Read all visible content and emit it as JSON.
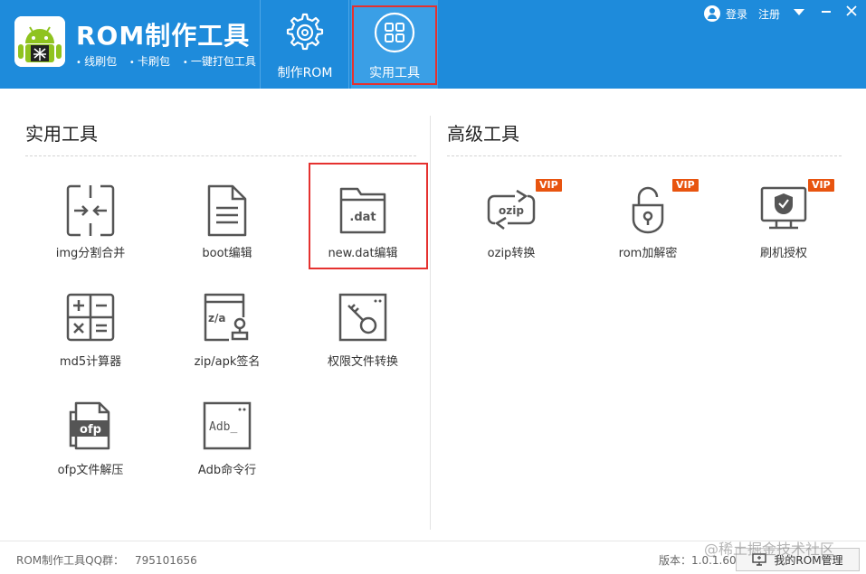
{
  "app": {
    "title": "ROM制作工具",
    "features": [
      "线刷包",
      "卡刷包",
      "一键打包工具"
    ]
  },
  "nav": {
    "tabs": [
      {
        "label": "制作ROM",
        "icon": "gear-disc-icon"
      },
      {
        "label": "实用工具",
        "icon": "grid-icon",
        "active": true
      }
    ]
  },
  "account": {
    "login": "登录",
    "register": "注册"
  },
  "sections": {
    "utilities": {
      "title": "实用工具",
      "tools": [
        {
          "label": "img分割合并",
          "icon": "split-merge-icon"
        },
        {
          "label": "boot编辑",
          "icon": "document-icon"
        },
        {
          "label": "new.dat编辑",
          "icon": "dat-folder-icon",
          "highlighted": true
        },
        {
          "label": "md5计算器",
          "icon": "calculator-icon"
        },
        {
          "label": "zip/apk签名",
          "icon": "zip-sign-icon"
        },
        {
          "label": "权限文件转换",
          "icon": "key-file-icon"
        },
        {
          "label": "ofp文件解压",
          "icon": "ofp-file-icon"
        },
        {
          "label": "Adb命令行",
          "icon": "terminal-icon"
        }
      ]
    },
    "advanced": {
      "title": "高级工具",
      "tools": [
        {
          "label": "ozip转换",
          "icon": "ozip-convert-icon",
          "badge": "VIP"
        },
        {
          "label": "rom加解密",
          "icon": "lock-icon",
          "badge": "VIP"
        },
        {
          "label": "刷机授权",
          "icon": "shield-monitor-icon",
          "badge": "VIP"
        }
      ]
    }
  },
  "icon_text": {
    "dat": ".dat",
    "za": "z/a",
    "ofp": "ofp",
    "adb": "Adb_",
    "ozip": "ozip"
  },
  "footer": {
    "qq_label": "ROM制作工具QQ群：",
    "qq_number": "795101656",
    "version_label": "版本：",
    "version": "1.0.1.60",
    "rom_button": "我的ROM管理",
    "watermark": "@稀土掘金技术社区"
  },
  "colors": {
    "header_bg": "#1e8bdb",
    "active_tab": "#3a9fe6",
    "highlight_border": "#e5312f",
    "vip_badge": "#e8540f",
    "icon_stroke": "#555555"
  }
}
